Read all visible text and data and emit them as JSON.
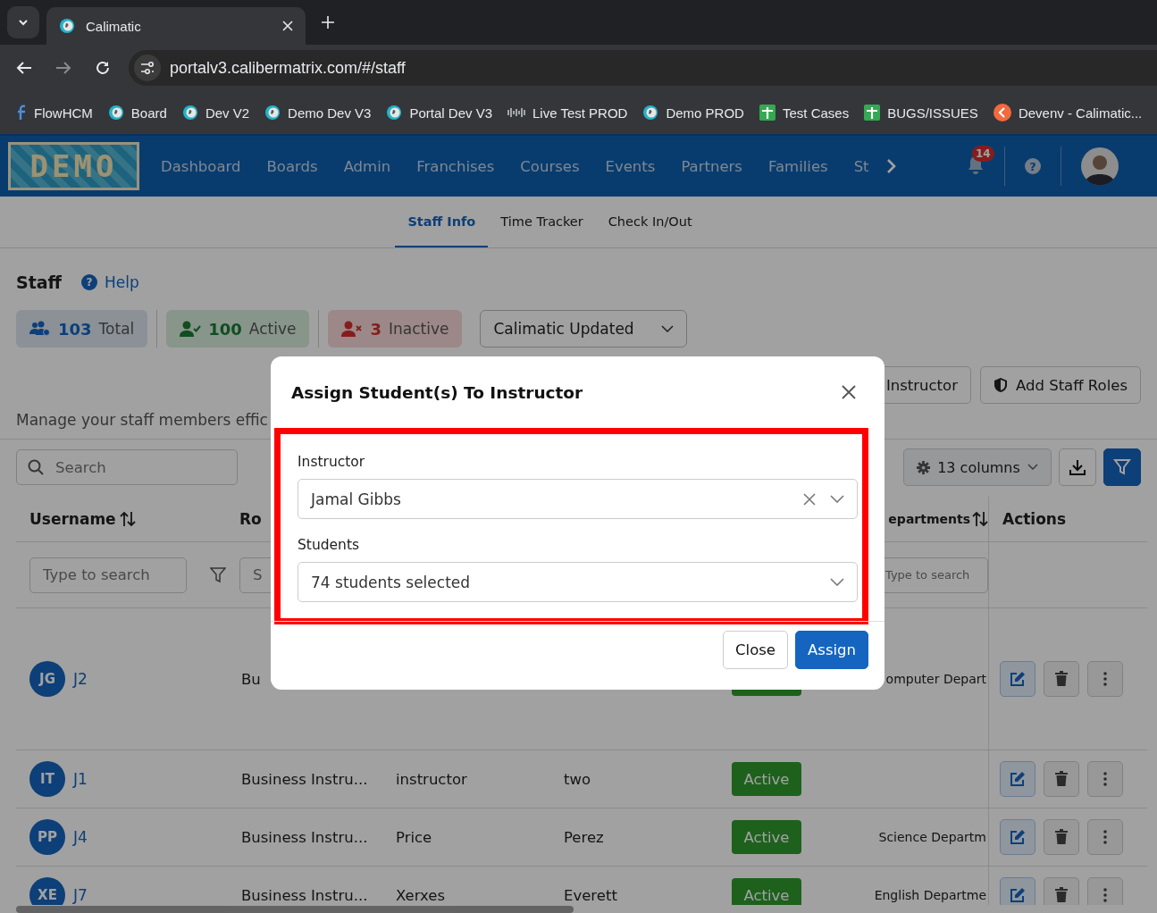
{
  "browser": {
    "tab_title": "Calimatic",
    "url": "portalv3.calibermatrix.com/#/staff",
    "bookmarks": [
      {
        "label": "FlowHCM",
        "kind": "flow"
      },
      {
        "label": "Board",
        "kind": "globe"
      },
      {
        "label": "Dev V2",
        "kind": "globe"
      },
      {
        "label": "Demo Dev V3",
        "kind": "globe"
      },
      {
        "label": "Portal Dev V3",
        "kind": "globe"
      },
      {
        "label": "Live Test PROD",
        "kind": "wave"
      },
      {
        "label": "Demo PROD",
        "kind": "globe"
      },
      {
        "label": "Test Cases",
        "kind": "sheet"
      },
      {
        "label": "BUGS/ISSUES",
        "kind": "sheet"
      },
      {
        "label": "Devenv - Calimatic...",
        "kind": "devenv"
      }
    ]
  },
  "nav": {
    "logo": "DEMO",
    "items": [
      "Dashboard",
      "Boards",
      "Admin",
      "Franchises",
      "Courses",
      "Events",
      "Partners",
      "Families",
      "St"
    ],
    "notification_count": "14",
    "help_icon": "?"
  },
  "subtabs": [
    {
      "label": "Staff Info",
      "selected": true
    },
    {
      "label": "Time Tracker",
      "selected": false
    },
    {
      "label": "Check In/Out",
      "selected": false
    }
  ],
  "page": {
    "title": "Staff",
    "help_link": "Help",
    "help_icon": "?",
    "stats": [
      {
        "kind": "total",
        "count": "103",
        "label": "Total"
      },
      {
        "kind": "active",
        "count": "100",
        "label": "Active"
      },
      {
        "kind": "inactive",
        "count": "3",
        "label": "Inactive"
      }
    ],
    "org_select": "Calimatic Updated",
    "actions": [
      "Instructor",
      "Add Staff Roles"
    ],
    "description": "Manage your staff members effic",
    "search_placeholder": "Search",
    "columns_button": "13 columns"
  },
  "table": {
    "columns": [
      {
        "kind": "username",
        "label": "Username",
        "sortable": true
      },
      {
        "kind": "role",
        "label": "Ro",
        "sortable": false
      },
      {
        "kind": "department",
        "label": "epartments",
        "sortable": true
      },
      {
        "kind": "actions",
        "label": "Actions",
        "sortable": false
      }
    ],
    "filters": [
      {
        "kind": "username",
        "placeholder": "Type to search"
      },
      {
        "kind": "role",
        "placeholder": "S"
      },
      {
        "kind": "department",
        "placeholder": "Type to search"
      }
    ],
    "rows": [
      {
        "initials": "JG",
        "username": "J2",
        "role": "Bu",
        "active": true,
        "department": "omputer Depart",
        "tall": true
      },
      {
        "initials": "IT",
        "username": "J1",
        "role": "Business Instru...",
        "column_3": "instructor",
        "column_4": "two",
        "active": true,
        "status": "Active",
        "tall": false
      },
      {
        "initials": "PP",
        "username": "J4",
        "role": "Business Instru...",
        "column_3": "Price",
        "column_4": "Perez",
        "active": true,
        "status": "Active",
        "department": "Science Departm",
        "tall": false
      },
      {
        "initials": "XE",
        "username": "J7",
        "role": "Business Instru...",
        "column_3": "Xerxes",
        "column_4": "Everett",
        "active": true,
        "status": "Active",
        "department": "English Departme",
        "tall": false
      }
    ]
  },
  "dialog": {
    "title": "Assign Student(s) To Instructor",
    "highlighted": true,
    "fields": [
      {
        "label": "Instructor",
        "value": "Jamal Gibbs",
        "clearable": true
      },
      {
        "label": "Students",
        "value": "74 students selected",
        "clearable": false
      }
    ],
    "buttons": [
      {
        "label": "Close",
        "primary": false
      },
      {
        "label": "Assign",
        "primary": true
      }
    ]
  }
}
